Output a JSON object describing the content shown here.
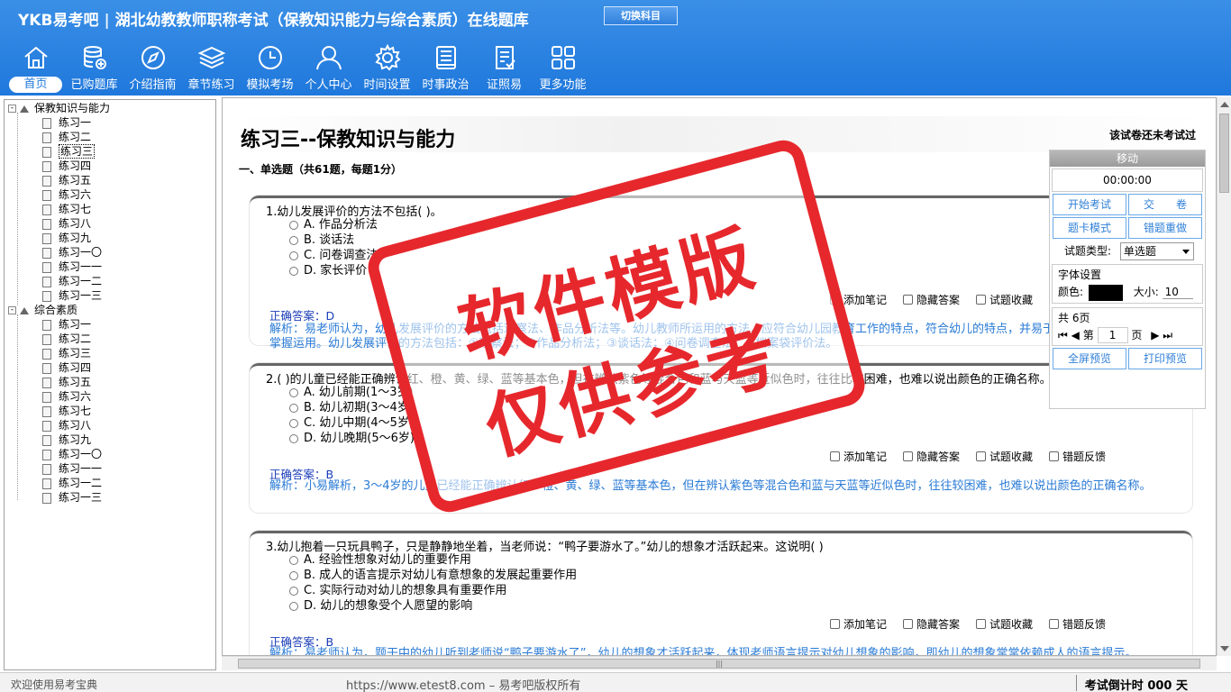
{
  "header": {
    "brand": "YKB易考吧",
    "separator": "|",
    "app_title": "湖北幼教教师职称考试（保教知识能力与综合素质）在线题库",
    "switch_label": "切换科目",
    "nav": [
      {
        "label": "首页",
        "icon": "home-icon"
      },
      {
        "label": "已购题库",
        "icon": "database-icon"
      },
      {
        "label": "介绍指南",
        "icon": "compass-icon"
      },
      {
        "label": "章节练习",
        "icon": "layers-icon"
      },
      {
        "label": "模拟考场",
        "icon": "clock-icon"
      },
      {
        "label": "个人中心",
        "icon": "user-icon"
      },
      {
        "label": "时间设置",
        "icon": "gear-icon"
      },
      {
        "label": "时事政治",
        "icon": "book-icon"
      },
      {
        "label": "证照易",
        "icon": "checklist-icon"
      },
      {
        "label": "更多功能",
        "icon": "grid-icon"
      }
    ]
  },
  "tree": {
    "groups": [
      {
        "label": "保教知识与能力",
        "toggle": "-",
        "items": [
          "练习一",
          "练习二",
          "练习三",
          "练习四",
          "练习五",
          "练习六",
          "练习七",
          "练习八",
          "练习九",
          "练习一〇",
          "练习一一",
          "练习一二",
          "练习一三"
        ]
      },
      {
        "label": "综合素质",
        "toggle": "-",
        "items": [
          "练习一",
          "练习二",
          "练习三",
          "练习四",
          "练习五",
          "练习六",
          "练习七",
          "练习八",
          "练习九",
          "练习一〇",
          "练习一一",
          "练习一二",
          "练习一三"
        ]
      }
    ],
    "selected_item": "练习三"
  },
  "exam": {
    "title": "练习三--保教知识与能力",
    "status": "该试卷还未考试过",
    "section": "一、单选题（共61题，每题1分）",
    "tools": [
      "添加笔记",
      "隐藏答案",
      "试题收藏",
      "错题反馈"
    ],
    "questions": [
      {
        "stem": "1.幼儿发展评价的方法不包括(  )。",
        "options": [
          "A. 作品分析法",
          "B. 谈话法",
          "C. 问卷调查法",
          "D. 家长评价"
        ],
        "answer": "正确答案：D",
        "explanation": "解析：易老师认为，幼儿发展评价的方法包括观察法、作品分析法等。幼儿教师所运用的方法，应符合幼儿园教育工作的特点，符合幼儿的特点，并易于为教师学习、练习和掌握运用。幼儿发展评价的方法包括：①观察法；②作品分析法；③谈话法；④问卷调查法；⑤档案袋评价法。"
      },
      {
        "stem": "2.(  )的儿童已经能正确辨认红、橙、黄、绿、蓝等基本色，但在辨认紫色等混合色和蓝与天蓝等近似色时，往往比较困难，也难以说出颜色的正确名称。",
        "options": [
          "A. 幼儿前期(1～3岁)",
          "B. 幼儿初期(3～4岁)",
          "C. 幼儿中期(4～5岁)",
          "D. 幼儿晚期(5～6岁)"
        ],
        "answer": "正确答案：B",
        "explanation": "解析：小易解析，3～4岁的儿童已经能正确辨认红、橙、黄、绿、蓝等基本色，但在辨认紫色等混合色和蓝与天蓝等近似色时，往往较困难，也难以说出颜色的正确名称。"
      },
      {
        "stem": "3.幼儿抱着一只玩具鸭子，只是静静地坐着，当老师说：“鸭子要游水了。”幼儿的想象才活跃起来。这说明(  )",
        "options": [
          "A. 经验性想象对幼儿的重要作用",
          "B. 成人的语言提示对幼儿有意想象的发展起重要作用",
          "C. 实际行动对幼儿的想象具有重要作用",
          "D. 幼儿的想象受个人愿望的影响"
        ],
        "answer": "正确答案：B",
        "explanation": "解析：易老师认为，题干中的幼儿听到老师说“鸭子要游水了”，幼儿的想象才活跃起来，体现老师语言提示对幼儿想象的影响，即幼儿的想象常常依赖成人的语言提示。"
      }
    ]
  },
  "control": {
    "move": "移动",
    "timer": "00:00:00",
    "start": "开始考试",
    "submit": "交　　卷",
    "card_mode": "题卡模式",
    "redo_wrong": "错题重做",
    "type_label": "试题类型:",
    "type_value": "单选题",
    "font_title": "字体设置",
    "color_label": "颜色:",
    "size_label": "大小:",
    "size_value": "10",
    "pages_label": "共 6页",
    "page_prefix": "第",
    "page_value": "1",
    "page_suffix": "页",
    "fullscreen": "全屏预览",
    "print": "打印预览"
  },
  "status": {
    "welcome": "欢迎使用易考宝典",
    "copyright": "https://www.etest8.com – 易考吧版权所有",
    "countdown": "考试倒计时 000 天"
  },
  "stamp": {
    "line1": "软件模版",
    "line2": "仅供参考"
  },
  "colors": {
    "header_blue": "#1f78dc",
    "answer_blue": "#1a3cb8",
    "explanation_blue": "#2a7bd6",
    "stamp_red": "#e6282d"
  }
}
